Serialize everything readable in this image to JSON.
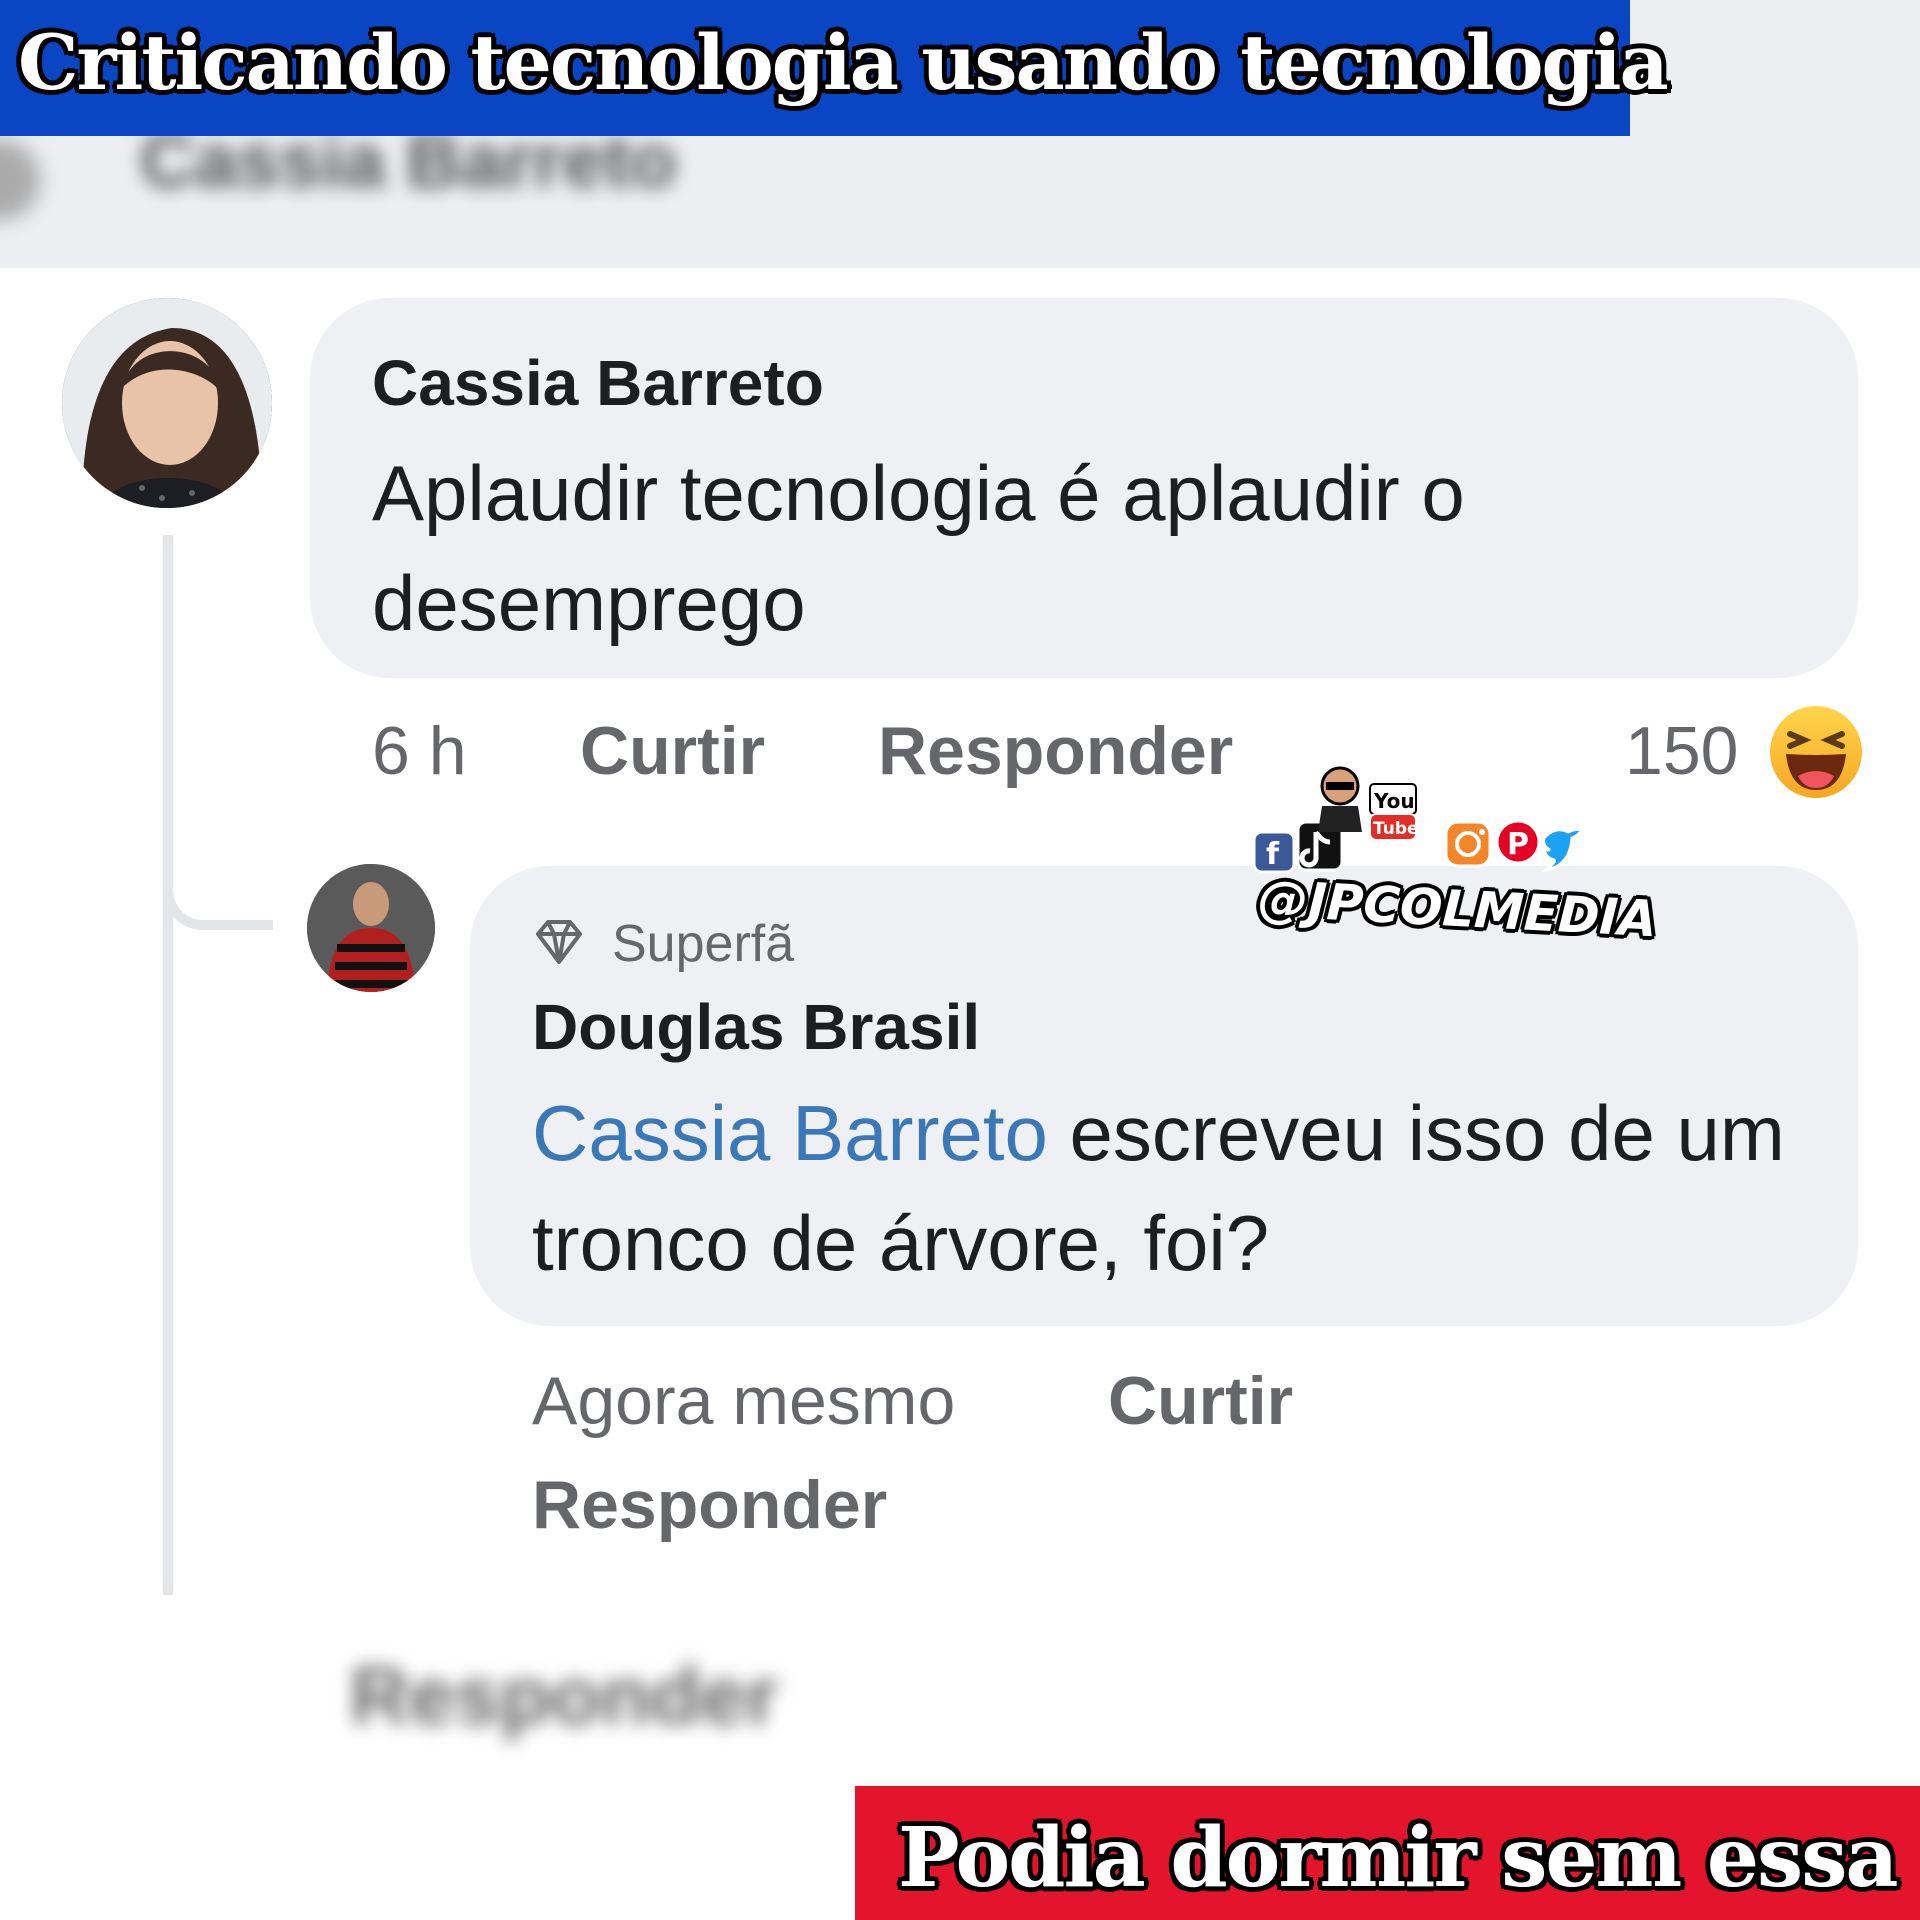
{
  "banner_top": {
    "text": "Criticando tecnologia usando tecnologia",
    "color": "#0a45c3"
  },
  "banner_bottom": {
    "text": "Podia dormir sem essa",
    "color": "#e3142c"
  },
  "blurred_top": {
    "name": "Cassia Barreto"
  },
  "comment": {
    "author": "Cassia Barreto",
    "text": "Aplaudir tecnologia é aplaudir o desemprego",
    "time": "6 h",
    "like_label": "Curtir",
    "reply_label": "Responder",
    "reaction_count": "150",
    "reaction_icon": "haha-emoji-icon"
  },
  "reply": {
    "badge": "Superfã",
    "badge_icon": "diamond-icon",
    "author": "Douglas Brasil",
    "mention": "Cassia Barreto",
    "text": " escreveu isso de um tronco de árvore, foi?",
    "time": "Agora mesmo",
    "like_label": "Curtir",
    "reply_label": "Responder",
    "mention_color": "#3b78b8"
  },
  "blurred_bottom": {
    "text": "Responder"
  },
  "watermark": {
    "handle": "@JPCOLMEDIA",
    "youtube_top": "You",
    "youtube_bottom": "Tube",
    "icons": [
      "facebook-icon",
      "tiktok-icon",
      "youtube-icon",
      "instagram-icon",
      "pinterest-icon",
      "twitter-icon"
    ]
  }
}
